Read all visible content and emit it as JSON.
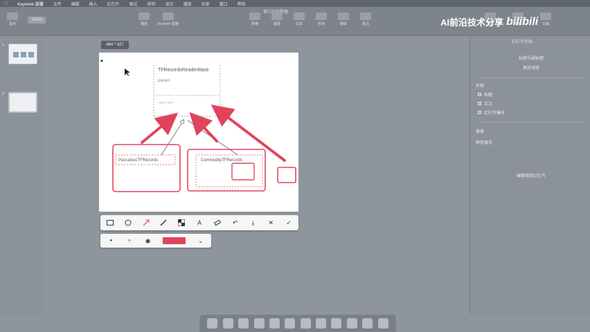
{
  "menubar": {
    "apple": "",
    "app_name": "Keynote 讲演",
    "items": [
      "文件",
      "编辑",
      "插入",
      "幻灯片",
      "格式",
      "排列",
      "显示",
      "播放",
      "共享",
      "窗口",
      "帮助"
    ]
  },
  "toolbar": {
    "document_title": "第三阶段数据",
    "zoom": "100%",
    "left_tools": [
      "显示",
      "缩放"
    ],
    "center_tools": [
      "播放",
      "Keynote 直播"
    ],
    "right_tools": [
      "表格",
      "图表",
      "文本",
      "形状",
      "媒体",
      "批注"
    ],
    "inspector_tools": [
      "格式",
      "动画",
      "文稿"
    ]
  },
  "watermark": {
    "text": "AI前沿技术分享",
    "logo": "bilibili"
  },
  "navigator": {
    "slides": [
      {
        "number": "1"
      },
      {
        "number": "2"
      }
    ]
  },
  "canvas": {
    "size_badge": "484 * 427",
    "slide": {
      "base_class_name": "TFRecordsReaderBase",
      "base_param": "param",
      "base_args": "args:nenr",
      "pascal_class": "PascalvocTFRecords",
      "commodity_class": "CommodityTFRecords"
    },
    "highlight_color": "#e0445c"
  },
  "annotation_toolbar": {
    "tools": [
      "rectangle-tool",
      "ellipse-tool",
      "arrow-tool",
      "pen-tool",
      "mosaic-tool",
      "text-tool",
      "eraser-tool",
      "undo",
      "save",
      "cancel",
      "confirm"
    ],
    "sub_options": [
      "dot-small",
      "dot-medium",
      "dot-large"
    ],
    "selected_color": "#e0445c"
  },
  "inspector": {
    "title": "幻灯片布局",
    "buttons": [
      "标题与副标题",
      "更改母版"
    ],
    "appearance_label": "外观",
    "checkboxes": [
      "标题",
      "正文",
      "幻灯片编号"
    ],
    "background_label": "背景",
    "fill_label": "颜色填充",
    "edit_layout_button": "编辑母版幻灯片"
  },
  "dock": {
    "apps": [
      "finder",
      "launchpad",
      "safari",
      "mail",
      "photos",
      "keynote",
      "pycharm",
      "terminal",
      "notes",
      "settings",
      "calculator",
      "trash"
    ]
  }
}
